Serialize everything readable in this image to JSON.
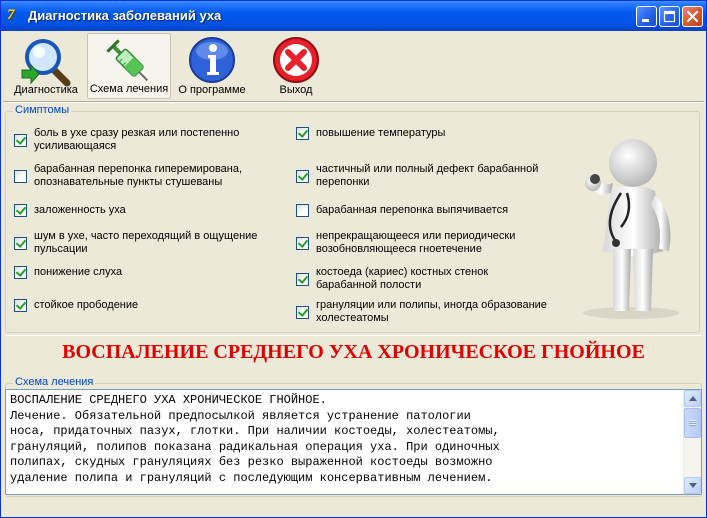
{
  "window": {
    "title": "Диагностика заболеваний уха",
    "app_icon": "7"
  },
  "toolbar": {
    "items": [
      {
        "label": "Диагностика",
        "icon": "magnifier-icon"
      },
      {
        "label": "Схема лечения",
        "icon": "syringe-icon",
        "active": true
      },
      {
        "label": "О программе",
        "icon": "info-icon"
      },
      {
        "label": "Выход",
        "icon": "exit-icon"
      }
    ]
  },
  "symptoms": {
    "title": "Симптомы",
    "left": [
      {
        "text": "боль в ухе сразу резкая или постепенно\nусиливающаяся",
        "checked": true
      },
      {
        "text": "барабанная перепонка гиперемирована,\nопознавательные пункты стушеваны",
        "checked": false
      },
      {
        "text": "заложенность уха",
        "checked": true
      },
      {
        "text": "шум в ухе, часто переходящий в ощущение\nпульсации",
        "checked": true
      },
      {
        "text": "понижение слуха",
        "checked": true
      },
      {
        "text": "стойкое прободение",
        "checked": true
      }
    ],
    "right": [
      {
        "text": "повышение температуры",
        "checked": true
      },
      {
        "text": "частичный или полный дефект барабанной\nперепонки",
        "checked": true
      },
      {
        "text": "барабанная перепонка выпячивается",
        "checked": false
      },
      {
        "text": "непрекращающееся или периодически\nвозобновляющееся гноетечение",
        "checked": true
      },
      {
        "text": "костоеда (кариес) костных стенок\nбарабанной полости",
        "checked": true
      },
      {
        "text": "грануляции или полипы, иногда образование\nхолестеатомы",
        "checked": true
      }
    ]
  },
  "diagnosis": {
    "text": "ВОСПАЛЕНИЕ СРЕДНЕГО УХА ХРОНИЧЕСКОЕ ГНОЙНОЕ",
    "color": "#e10000"
  },
  "treatment": {
    "title": "Схема лечения",
    "lines": [
      "ВОСПАЛЕНИЕ СРЕДНЕГО УХА ХРОНИЧЕСКОЕ ГНОЙНОЕ.",
      "Лечение. Обязательной предпосылкой является устранение патологии",
      "носа, придаточных пазух, глотки. При наличии костоеды, холестеатомы,",
      "грануляций, полипов показана радикальная операция уха. При одиночных",
      "полипах, скудных грануляциях без резко выраженной костоеды возможно",
      "удаление полипа и грануляций с последующим консервативным лечением."
    ]
  }
}
